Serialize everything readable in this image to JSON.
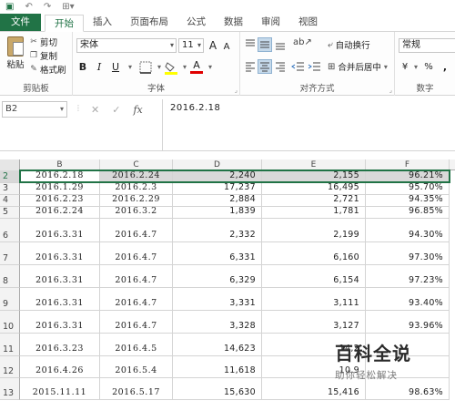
{
  "quick_access": [
    "▣",
    "↶",
    "↷",
    "⊞▾"
  ],
  "tabs": [
    {
      "label": "文件"
    },
    {
      "label": "开始"
    },
    {
      "label": "插入"
    },
    {
      "label": "页面布局"
    },
    {
      "label": "公式"
    },
    {
      "label": "数据"
    },
    {
      "label": "审阅"
    },
    {
      "label": "视图"
    }
  ],
  "ribbon": {
    "clipboard": {
      "paste_label": "粘贴",
      "cut_label": "剪切",
      "copy_label": "复制",
      "format_painter_label": "格式刷",
      "group_label": "剪贴板"
    },
    "font": {
      "font_name": "宋体",
      "font_size": "11",
      "grow": "A",
      "shrink": "A",
      "bold": "B",
      "italic": "I",
      "underline": "U",
      "font_color": "A",
      "group_label": "字体"
    },
    "alignment": {
      "wrap_text_label": "自动换行",
      "merge_center_label": "合并后居中",
      "group_label": "对齐方式"
    },
    "number": {
      "format": "常规",
      "currency": "¥",
      "percent": "%",
      "comma": ",",
      "group_label": "数字"
    }
  },
  "formula_bar": {
    "name_box": "B2",
    "cancel": "✕",
    "enter": "✓",
    "fx": "fx",
    "value": "2016.2.18"
  },
  "sheet": {
    "columns": [
      "B",
      "C",
      "D",
      "E",
      "F"
    ],
    "rows": [
      {
        "num": "2",
        "b": "2016.2.18",
        "c": "2016.2.24",
        "d": "2,240",
        "e": "2,155",
        "f": "96.21%"
      },
      {
        "num": "3",
        "b": "2016.1.29",
        "c": "2016.2.3",
        "d": "17,237",
        "e": "16,495",
        "f": "95.70%"
      },
      {
        "num": "4",
        "b": "2016.2.23",
        "c": "2016.2.29",
        "d": "2,884",
        "e": "2,721",
        "f": "94.35%"
      },
      {
        "num": "5",
        "b": "2016.2.24",
        "c": "2016.3.2",
        "d": "1,839",
        "e": "1,781",
        "f": "96.85%"
      },
      {
        "num": "6",
        "b": "2016.3.31",
        "c": "2016.4.7",
        "d": "2,332",
        "e": "2,199",
        "f": "94.30%"
      },
      {
        "num": "7",
        "b": "2016.3.31",
        "c": "2016.4.7",
        "d": "6,331",
        "e": "6,160",
        "f": "97.30%"
      },
      {
        "num": "8",
        "b": "2016.3.31",
        "c": "2016.4.7",
        "d": "6,329",
        "e": "6,154",
        "f": "97.23%"
      },
      {
        "num": "9",
        "b": "2016.3.31",
        "c": "2016.4.7",
        "d": "3,331",
        "e": "3,111",
        "f": "93.40%"
      },
      {
        "num": "10",
        "b": "2016.3.31",
        "c": "2016.4.7",
        "d": "3,328",
        "e": "3,127",
        "f": "93.96%"
      },
      {
        "num": "11",
        "b": "2016.3.23",
        "c": "2016.4.5",
        "d": "14,623",
        "e": "14,2",
        "f": ""
      },
      {
        "num": "12",
        "b": "2016.4.26",
        "c": "2016.5.4",
        "d": "11,618",
        "e": "10,9",
        "f": ""
      },
      {
        "num": "13",
        "b": "2015.11.11",
        "c": "2016.5.17",
        "d": "15,630",
        "e": "15,416",
        "f": "98.63%"
      }
    ]
  },
  "watermark": {
    "title": "百科全说",
    "subtitle": "助你轻松解决"
  }
}
